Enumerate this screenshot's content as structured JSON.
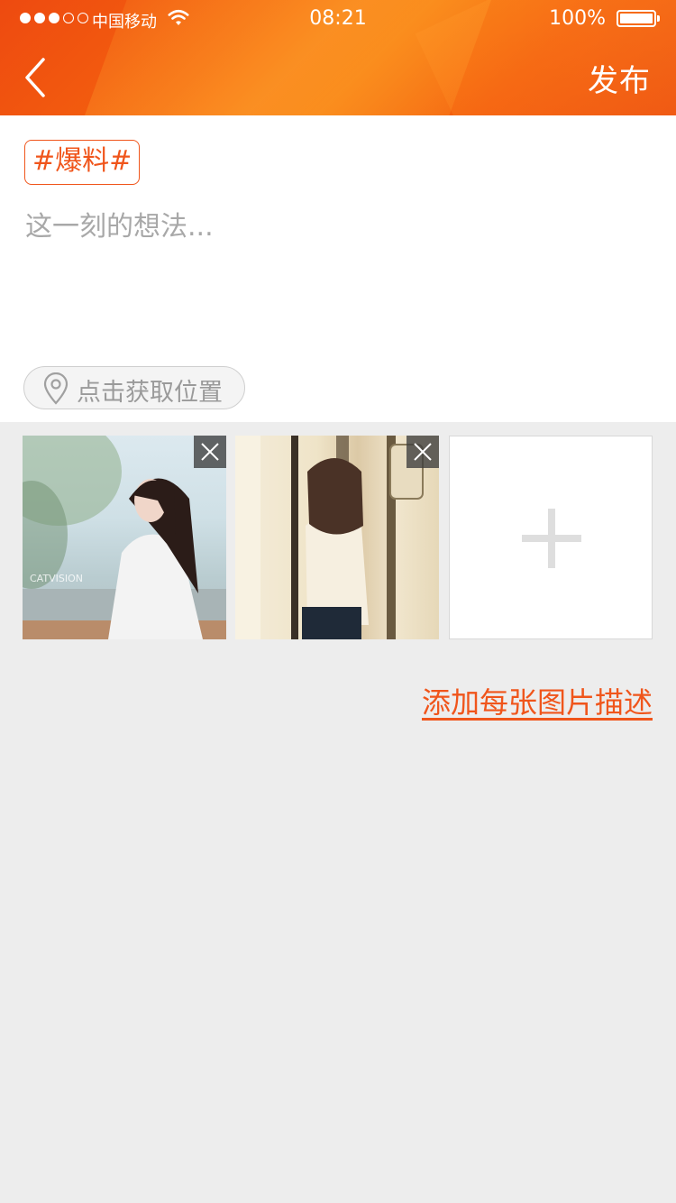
{
  "status_bar": {
    "signal_bars_on": 3,
    "signal_bars_total": 5,
    "carrier": "中国移动",
    "wifi_icon": "wifi-icon",
    "time": "08:21",
    "battery_percent": "100%",
    "battery_level": 1.0
  },
  "nav": {
    "back_icon": "chevron-left-icon",
    "publish_label": "发布"
  },
  "compose": {
    "topic_tag": "#爆料#",
    "placeholder": "这一刻的想法...",
    "location_icon": "location-pin-icon",
    "location_label": "点击获取位置"
  },
  "photos": {
    "items": [
      {
        "remove_icon": "close-icon",
        "watermark": "CATVISION"
      },
      {
        "remove_icon": "close-icon"
      }
    ],
    "add_icon": "plus-icon"
  },
  "add_description_label": "添加每张图片描述",
  "colors": {
    "accent": "#f0551b",
    "header_gradient_start": "#ee4a10",
    "header_gradient_end": "#f7780e",
    "page_background": "#ededed",
    "placeholder_text": "#a8a8a8"
  }
}
